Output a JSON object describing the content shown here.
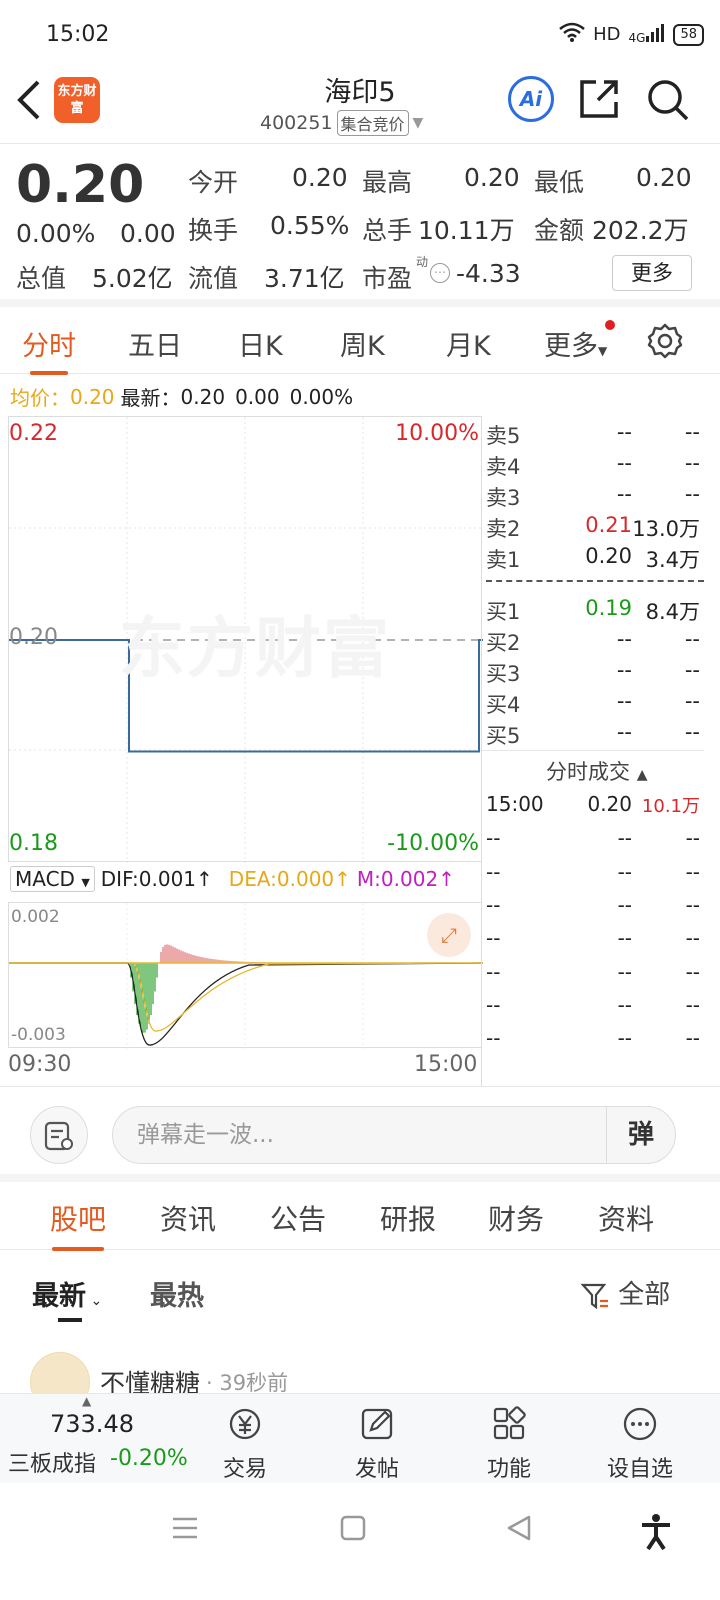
{
  "status_bar": {
    "time": "15:02",
    "network": "HD",
    "signal": "4G",
    "battery": "58"
  },
  "header": {
    "back_icon": "back-arrow-icon",
    "logo_text": "东方财富",
    "title": "海印5",
    "code": "400251",
    "auction_tag": "集合竞价",
    "ai_label": "Ai"
  },
  "quote": {
    "price": "0.20",
    "change_pct": "0.00%",
    "change": "0.00",
    "open_label": "今开",
    "open": "0.20",
    "high_label": "最高",
    "high": "0.20",
    "low_label": "最低",
    "low": "0.20",
    "turnover_label": "换手",
    "turnover": "0.55%",
    "volume_label": "总手",
    "volume": "10.11万",
    "amount_label": "金额",
    "amount": "202.2万",
    "mktcap_label": "总值",
    "mktcap": "5.02亿",
    "float_label": "流值",
    "float": "3.71亿",
    "pe_label": "市盈",
    "pe_sup": "动",
    "pe": "-4.33",
    "more_label": "更多"
  },
  "chart_tabs": [
    "分时",
    "五日",
    "日K",
    "周K",
    "月K",
    "更多"
  ],
  "avg_line": {
    "label": "均价：",
    "avg": "0.20",
    "latest_label": "最新：",
    "latest": "0.20",
    "change": "0.00",
    "change_pct": "0.00%"
  },
  "chart_labels": {
    "top_price": "0.22",
    "top_pct": "10.00%",
    "mid_price": "0.20",
    "bottom_price": "0.18",
    "bottom_pct": "-10.00%",
    "watermark": "东方财富",
    "time_start": "09:30",
    "time_end": "15:00"
  },
  "macd": {
    "selector": "MACD",
    "dif": "DIF:0.001↑",
    "dea": "DEA:0.000↑",
    "m": "M:0.002↑",
    "top": "0.002",
    "bottom": "-0.003"
  },
  "order_book": {
    "asks": [
      {
        "label": "卖5",
        "price": "--",
        "vol": "--"
      },
      {
        "label": "卖4",
        "price": "--",
        "vol": "--"
      },
      {
        "label": "卖3",
        "price": "--",
        "vol": "--"
      },
      {
        "label": "卖2",
        "price": "0.21",
        "vol": "13.0万"
      },
      {
        "label": "卖1",
        "price": "0.20",
        "vol": "3.4万"
      }
    ],
    "bids": [
      {
        "label": "买1",
        "price": "0.19",
        "vol": "8.4万"
      },
      {
        "label": "买2",
        "price": "--",
        "vol": "--"
      },
      {
        "label": "买3",
        "price": "--",
        "vol": "--"
      },
      {
        "label": "买4",
        "price": "--",
        "vol": "--"
      },
      {
        "label": "买5",
        "price": "--",
        "vol": "--"
      }
    ]
  },
  "trades": {
    "header": "分时成交",
    "rows": [
      {
        "time": "15:00",
        "price": "0.20",
        "vol": "10.1万"
      },
      {
        "time": "--",
        "price": "--",
        "vol": "--"
      },
      {
        "time": "--",
        "price": "--",
        "vol": "--"
      },
      {
        "time": "--",
        "price": "--",
        "vol": "--"
      },
      {
        "time": "--",
        "price": "--",
        "vol": "--"
      },
      {
        "time": "--",
        "price": "--",
        "vol": "--"
      },
      {
        "time": "--",
        "price": "--",
        "vol": "--"
      },
      {
        "time": "--",
        "price": "--",
        "vol": "--"
      }
    ]
  },
  "danmu": {
    "placeholder": "弹幕走一波...",
    "button": "弹"
  },
  "section_tabs": [
    "股吧",
    "资讯",
    "公告",
    "研报",
    "财务",
    "资料"
  ],
  "feed_filter": {
    "latest": "最新",
    "hot": "最热",
    "all": "全部"
  },
  "post": {
    "author": "不懂糖糖",
    "time": "· 39秒前"
  },
  "bottom_bar": {
    "index_value": "733.48",
    "index_name": "三板成指",
    "index_change": "-0.20%",
    "items": [
      "交易",
      "发帖",
      "功能",
      "设自选"
    ]
  },
  "chart_data": {
    "type": "line",
    "x": [
      "09:30",
      "10:30",
      "15:00"
    ],
    "series": [
      {
        "values": [
          0.2,
          0.19,
          0.2
        ]
      }
    ],
    "ylim": [
      0.18,
      0.22
    ],
    "reference": 0.2
  }
}
